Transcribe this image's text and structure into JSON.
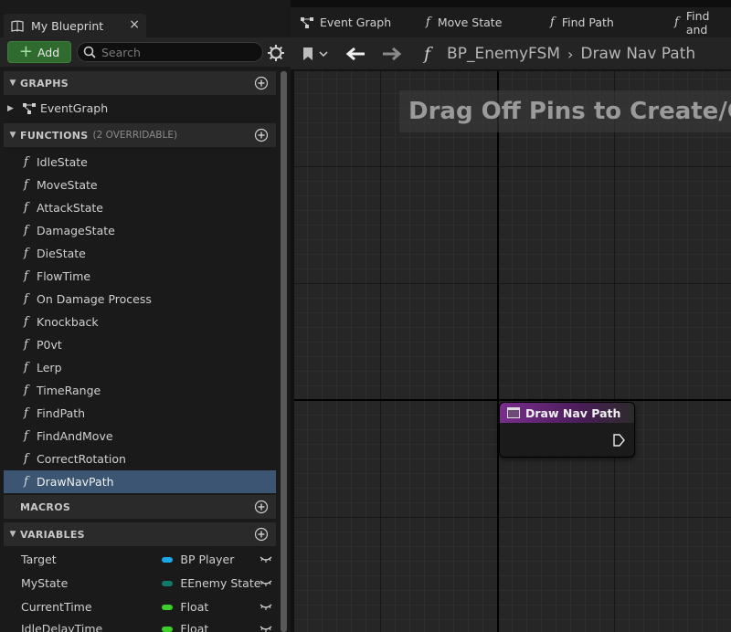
{
  "panel": {
    "tab_title": "My Blueprint",
    "close": "×"
  },
  "toolbar": {
    "add_label": "Add",
    "search_placeholder": "Search"
  },
  "sections": {
    "graphs": "GRAPHS",
    "functions": "FUNCTIONS",
    "functions_sub": "(2 OVERRIDABLE)",
    "macros": "MACROS",
    "variables": "VARIABLES"
  },
  "graphs_items": [
    "EventGraph"
  ],
  "functions": [
    "IdleState",
    "MoveState",
    "AttackState",
    "DamageState",
    "DieState",
    "FlowTime",
    "On Damage Process",
    "Knockback",
    "P0vt",
    "Lerp",
    "TimeRange",
    "FindPath",
    "FindAndMove",
    "CorrectRotation",
    "DrawNavPath"
  ],
  "selected_function": "DrawNavPath",
  "variables": [
    {
      "name": "Target",
      "type": "BP Player",
      "color": "#1aa8e8"
    },
    {
      "name": "MyState",
      "type": "EEnemy State",
      "color": "#0f7a6a"
    },
    {
      "name": "CurrentTime",
      "type": "Float",
      "color": "#3ccf2a"
    },
    {
      "name": "IdleDelayTime",
      "type": "Float",
      "color": "#3ccf2a"
    }
  ],
  "graph_tabs": [
    {
      "label": "Event Graph",
      "icon": "event-graph-icon"
    },
    {
      "label": "Move State",
      "icon": "function-icon"
    },
    {
      "label": "Find Path",
      "icon": "function-icon"
    },
    {
      "label": "Find and",
      "icon": "function-icon"
    }
  ],
  "breadcrumb": {
    "blueprint": "BP_EnemyFSM",
    "function": "Draw Nav Path"
  },
  "canvas": {
    "hint": "Drag Off Pins to Create/Con"
  },
  "node": {
    "title": "Draw Nav Path"
  },
  "colors": {
    "selection": "#3c5573",
    "add_button": "#2f6b2f",
    "node_header": "#7a2d8e"
  }
}
